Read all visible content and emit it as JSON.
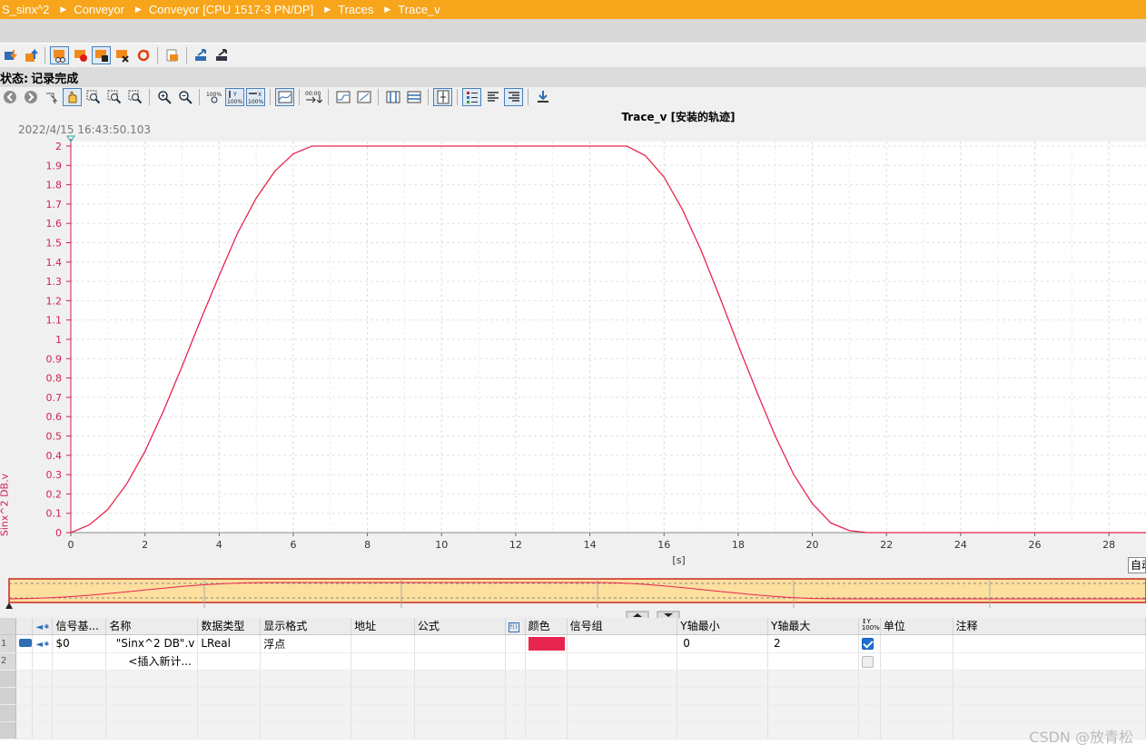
{
  "breadcrumb": {
    "items": [
      "S_sinx^2",
      "Conveyor",
      "Conveyor [CPU 1517-3 PN/DP]",
      "Traces",
      "Trace_v"
    ]
  },
  "status": {
    "label": "状态:",
    "value": "记录完成"
  },
  "chart_title": "Trace_v [安装的轨迹]",
  "timestamp": "2022/4/15 16:43:50.103",
  "auto_label": "自动",
  "colors": {
    "accent": "#f7a51b",
    "signal": "#e8254f",
    "checkbox": "#1d6fd0"
  },
  "toolbar1_icons": [
    "download-to-device-icon",
    "upload-from-device-icon",
    "record-settings-icon",
    "record-start-icon",
    "record-stop-icon",
    "record-delete-icon",
    "record-repeat-icon",
    "export-icon",
    "add-measurement-icon",
    "compare-icon"
  ],
  "toolbar2_icons": [
    "back-icon",
    "forward-icon",
    "select-icon",
    "pan-hand-icon",
    "zoom-area-icon",
    "zoom-x-icon",
    "zoom-y-icon",
    "zoom-in-icon",
    "zoom-out-icon",
    "zoom-100-icon",
    "zoom-y-100-icon",
    "zoom-x-100-icon",
    "autoscale-icon",
    "time-scale-icon",
    "curve-step-icon",
    "curve-line-icon",
    "vertical-cursor-icon",
    "horizontal-cursor-icon",
    "measure-icon",
    "legend-icon",
    "align-left-icon",
    "align-right-icon",
    "export-csv-icon"
  ],
  "chart_data": {
    "type": "line",
    "title": "Trace_v [安装的轨迹]",
    "xlabel": "[s]",
    "ylabel": "Sinx^2 DB.v",
    "xlim": [
      0,
      29
    ],
    "ylim": [
      0,
      2
    ],
    "xticks": [
      "0",
      "2",
      "4",
      "6",
      "8",
      "10",
      "12",
      "14",
      "16",
      "18",
      "20",
      "22",
      "24",
      "26",
      "28"
    ],
    "yticks": [
      "0",
      "0.1",
      "0.2",
      "0.3",
      "0.4",
      "0.5",
      "0.6",
      "0.7",
      "0.8",
      "0.9",
      "1",
      "1.1",
      "1.2",
      "1.3",
      "1.4",
      "1.5",
      "1.6",
      "1.7",
      "1.8",
      "1.9",
      "2"
    ],
    "grid": true,
    "series": [
      {
        "name": "\"Sinx^2 DB\".v",
        "color": "#e8254f",
        "x": [
          0,
          0.5,
          1,
          1.5,
          2,
          2.5,
          3,
          3.5,
          4,
          4.5,
          5,
          5.5,
          6,
          6.5,
          7,
          8,
          10,
          12,
          14,
          15,
          15.5,
          16,
          16.5,
          17,
          17.5,
          18,
          18.5,
          19,
          19.5,
          20,
          20.5,
          21,
          21.5,
          22,
          24,
          26,
          28,
          29
        ],
        "y": [
          0,
          0.04,
          0.12,
          0.25,
          0.42,
          0.63,
          0.86,
          1.1,
          1.33,
          1.55,
          1.73,
          1.87,
          1.96,
          2.0,
          2.0,
          2.0,
          2.0,
          2.0,
          2.0,
          2.0,
          1.95,
          1.84,
          1.67,
          1.46,
          1.22,
          0.97,
          0.73,
          0.5,
          0.3,
          0.15,
          0.05,
          0.01,
          0.0,
          0.0,
          0.0,
          0.0,
          0.0,
          0.0
        ]
      }
    ]
  },
  "table": {
    "headers": [
      "",
      "",
      "信号基...",
      "名称",
      "数据类型",
      "显示格式",
      "地址",
      "公式",
      "",
      "颜色",
      "信号组",
      "Y轴最小",
      "Y轴最大",
      "",
      "单位",
      "注释"
    ],
    "rows": [
      {
        "num": "1",
        "base": "$0",
        "name": "\"Sinx^2 DB\".v",
        "type": "LReal",
        "format": "浮点",
        "address": "",
        "formula": "",
        "color": "#e8254f",
        "group": "",
        "ymin": "0",
        "ymax": "2",
        "checked": true,
        "unit": "",
        "comment": ""
      },
      {
        "num": "2",
        "base": "",
        "name": "<插入新计...",
        "type": "",
        "format": "",
        "address": "",
        "formula": "",
        "color": "",
        "group": "",
        "ymin": "",
        "ymax": "",
        "checked": false,
        "unit": "",
        "comment": ""
      }
    ]
  },
  "watermark": "CSDN @放青松"
}
